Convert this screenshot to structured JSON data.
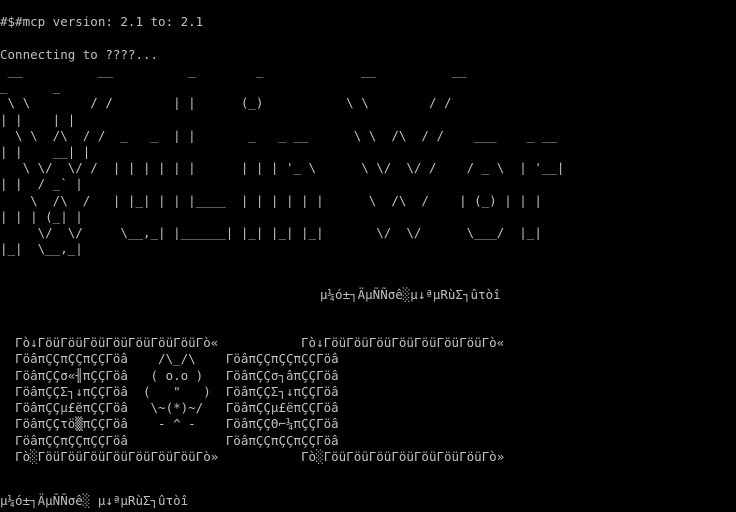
{
  "terminal": {
    "background": "#000000",
    "foreground": "#c0c0c0",
    "prompt_line": "#$#mcp version: 2.1 to: 2.1",
    "connecting_line": "Connecting to ????...",
    "banner_lines": [
      " __          __          _        _             __          __",
      "_      _",
      " \\ \\        / /        | |      (_)           \\ \\        / /",
      "| |    | |",
      "  \\ \\  /\\  / /  _   _  | |       _   _ __      \\ \\  /\\  / /    ___    _ __",
      "| |    __| |",
      "   \\ \\/  \\/ /  | | | | | |      | | | '_ \\      \\ \\/  \\/ /    / _ \\  | '__|",
      "| |  / _` |",
      "    \\  /\\  /   | |_| | | |____  | | | | | |      \\  /\\  /    | (_) | | |",
      "| | | (_| |",
      "     \\/  \\/     \\__,_| |______| |_| |_| |_|       \\/  \\/      \\___/  |_|",
      "|_|  \\__,_|"
    ],
    "centered_garbled_line": "µ¼ó±┐ÄµÑÑσê░µ↓ªµRùΣ┐ûτòî",
    "box_art_lines": [
      "  Γò↓ΓöüΓöüΓöüΓöüΓöüΓöüΓöüΓò«           Γò↓ΓöüΓöüΓöüΓöüΓöüΓöüΓöüΓò«",
      "  ΓöâπÇÇπÇÇπÇÇΓöâ    /\\_/\\    ΓöâπÇÇπÇÇπÇÇΓöâ",
      "  ΓöâπÇÇσ«╢πÇÇΓöâ   ( o.o )   ΓöâπÇÇσ┐âπÇÇΓöâ",
      "  ΓöâπÇÇΣ┐↓πÇÇΓöâ  (   \"   )  ΓöâπÇÇΣ┐↓πÇÇΓöâ",
      "  ΓöâπÇÇµ£ëπÇÇΓöâ   \\~(*)~/   ΓöâπÇÇµ£ëπÇÇΓöâ",
      "  ΓöâπÇÇτö▒πÇÇΓöâ    - ^ -    ΓöâπÇÇΘ⌐¼πÇÇΓöâ",
      "  ΓöâπÇÇπÇÇπÇÇΓöâ             ΓöâπÇÇπÇÇπÇÇΓöâ",
      "  Γò░ΓöüΓöüΓöüΓöüΓöüΓöüΓöüΓò»           Γò░ΓöüΓöüΓöüΓöüΓöüΓöüΓöüΓò»"
    ],
    "bottom_garbled_line": "µ¼ó±┐ÄµÑÑσê░ µ↓ªµRùΣ┐ûτòî"
  }
}
